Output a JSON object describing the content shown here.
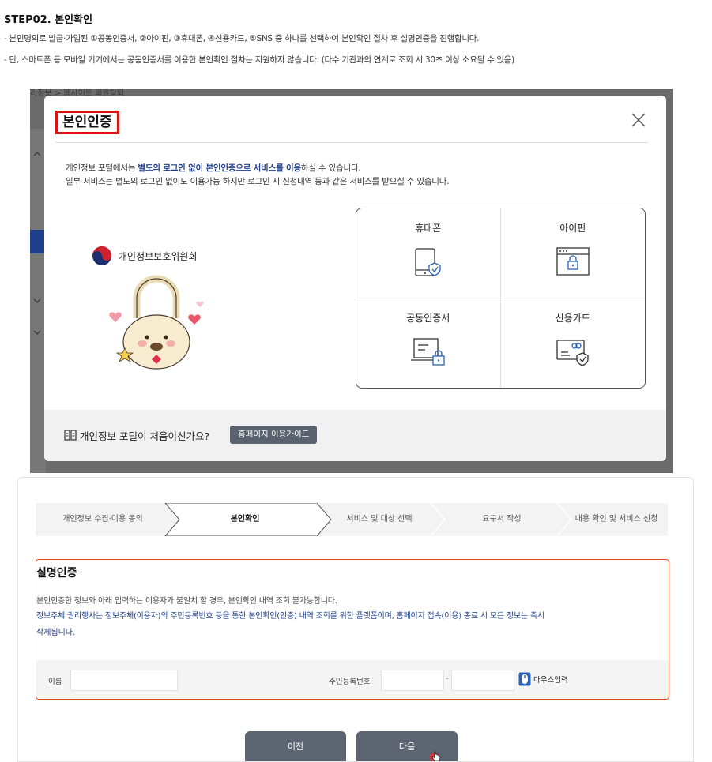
{
  "instructions": {
    "title": "STEP02. 본인확인",
    "line1": "- 본인명의로 발급·가입된 ①공동인증서, ②아이핀, ③휴대폰, ④신용카드, ⑤SNS 중 하나를 선택하여 본인확인 절차 후 실명인증을 진행합니다.",
    "line2": "- 단, 스마트폰 등 모바일 기기에서는 공동인증서를 이용한 본인확인 절차는 지원하지 않습니다. (다수 기관과의 연계로 조회 시 30초 이상 소요될 수 있음)"
  },
  "background": {
    "breadcrumb": "리정보 > 웹사이트 회원탈퇴"
  },
  "modal": {
    "title": "본인인증",
    "desc1_pre": "개인정보 포털에서는 ",
    "desc1_hl": "별도의 로그인 없이 본인인증으로 서비스를 이용",
    "desc1_post": "하실 수 있습니다.",
    "desc2": "일부 서비스는 별도의 로그인 없이도 이용가능 하지만 로그인 시 신청내역 등과 같은 서비스를 받으실 수 있습니다.",
    "org_name": "개인정보보호위원회",
    "auth_methods": [
      {
        "label": "휴대폰",
        "icon": "mobile-shield-icon"
      },
      {
        "label": "아이핀",
        "icon": "ipin-window-lock-icon"
      },
      {
        "label": "공동인증서",
        "icon": "certificate-laptop-lock-icon"
      },
      {
        "label": "신용카드",
        "icon": "credit-card-shield-icon"
      }
    ],
    "footer_text": "개인정보 포털이 처음이신가요?",
    "footer_button": "홈페이지 이용가이드"
  },
  "form": {
    "steps": [
      "개인정보 수집·이용 동의",
      "본인확인",
      "서비스 및 대상 선택",
      "요구서 작성",
      "내용 확인 및 서비스 신청"
    ],
    "active_step": 1,
    "section_title": "실명인증",
    "notice1": "본인인증한 정보와 아래 입력하는 이용자가 불일치 할 경우, 본인확인 내역 조회 불가능합니다.",
    "notice2": "정보주체 권리행사는 정보주체(이용자)의 주민등록번호 등을 통한 본인확인(인증) 내역 조회를 위한 플랫폼이며, 홈페이지 접속(이용) 종료 시 모든 정보는 즉시",
    "notice3": "삭제됩니다.",
    "name_label": "이름",
    "name_value": "",
    "rrn_label": "주민등록번호",
    "rrn_front": "",
    "rrn_back": "",
    "rrn_separator": "-",
    "mouse_input_label": "마우스입력",
    "prev_button": "이전",
    "next_button": "다음"
  },
  "colors": {
    "accent_blue": "#1f3f8a",
    "highlight_red": "#d11111",
    "form_border_orange": "#e04a1a",
    "button_gray": "#5d6573"
  }
}
